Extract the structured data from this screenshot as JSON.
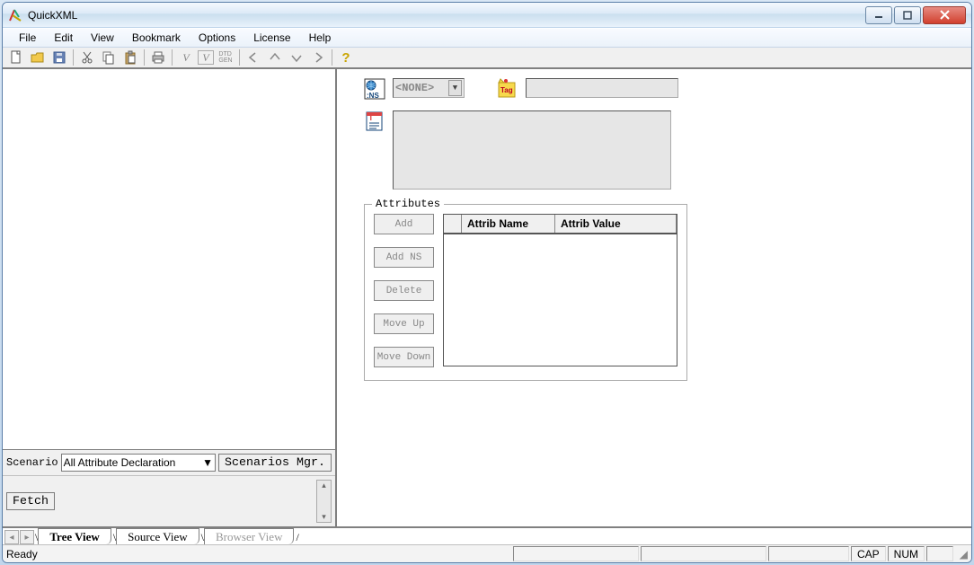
{
  "app": {
    "title": "QuickXML"
  },
  "menu": {
    "file": "File",
    "edit": "Edit",
    "view": "View",
    "bookmark": "Bookmark",
    "options": "Options",
    "license": "License",
    "help": "Help"
  },
  "toolbar_icons": [
    "new",
    "open",
    "save",
    "cut",
    "copy",
    "paste",
    "print",
    "validate-v",
    "validate-w",
    "gen",
    "left",
    "up",
    "down",
    "right",
    "help"
  ],
  "right": {
    "ns_select": "<NONE>",
    "tag_value": "",
    "textarea_value": "",
    "attributes_legend": "Attributes",
    "buttons": {
      "add": "Add",
      "addns": "Add NS",
      "delete": "Delete",
      "moveup": "Move Up",
      "movedown": "Move Down"
    },
    "table": {
      "col0": "",
      "col1": "Attrib Name",
      "col2": "Attrib Value"
    }
  },
  "scenario": {
    "label": "Scenario",
    "selected": "All Attribute Declaration",
    "mgr_btn": "Scenarios Mgr.",
    "fetch_btn": "Fetch"
  },
  "tabs": {
    "tree": "Tree View",
    "source": "Source View",
    "browser": "Browser View"
  },
  "status": {
    "ready": "Ready",
    "cap": "CAP",
    "num": "NUM"
  }
}
